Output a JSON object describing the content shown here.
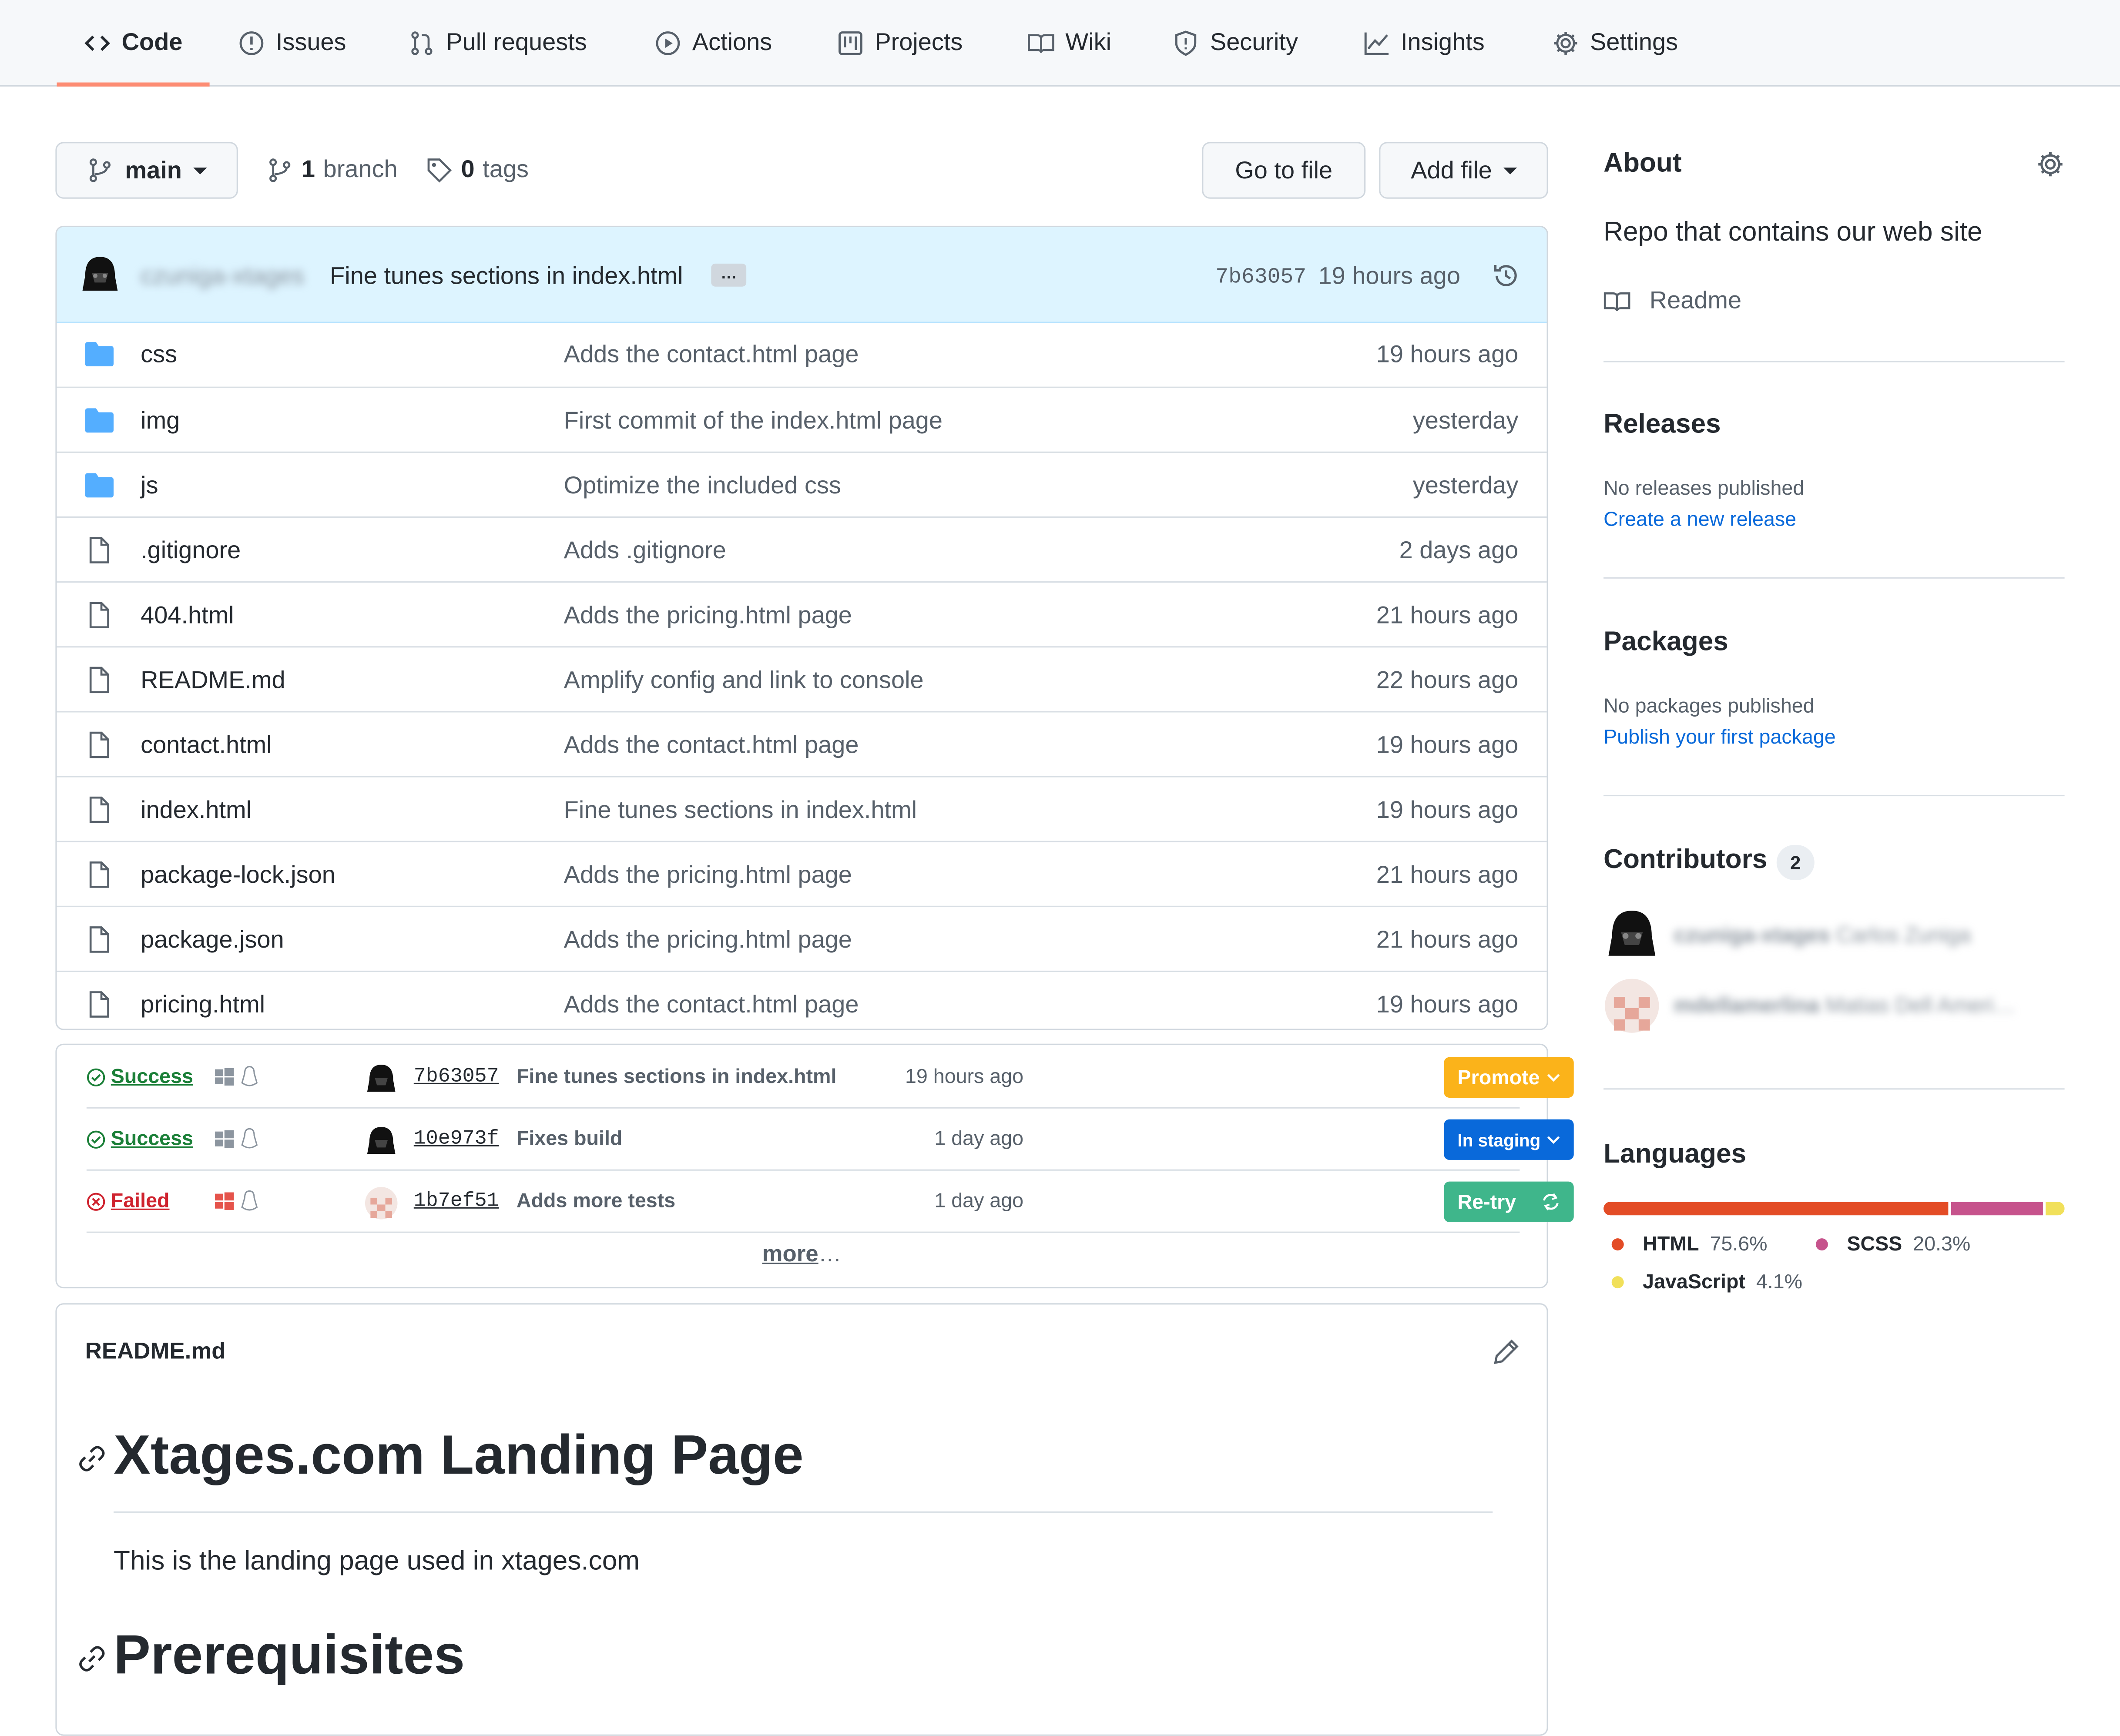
{
  "nav": {
    "tabs": [
      {
        "label": "Code",
        "icon": "code-icon"
      },
      {
        "label": "Issues",
        "icon": "issue-icon"
      },
      {
        "label": "Pull requests",
        "icon": "pull-request-icon"
      },
      {
        "label": "Actions",
        "icon": "play-icon"
      },
      {
        "label": "Projects",
        "icon": "project-icon"
      },
      {
        "label": "Wiki",
        "icon": "book-icon"
      },
      {
        "label": "Security",
        "icon": "shield-icon"
      },
      {
        "label": "Insights",
        "icon": "graph-icon"
      },
      {
        "label": "Settings",
        "icon": "gear-icon"
      }
    ]
  },
  "toolbar": {
    "branch_name": "main",
    "branch_count": "1",
    "branch_label": "branch",
    "tag_count": "0",
    "tag_label": "tags",
    "go_to_file": "Go to file",
    "add_file": "Add file"
  },
  "latest_commit": {
    "author": "czuniga-xtages",
    "message": "Fine tunes sections in index.html",
    "ellipsis": "…",
    "sha": "7b63057",
    "age": "19 hours ago"
  },
  "files": [
    {
      "name": "css",
      "type": "dir",
      "message": "Adds the contact.html page",
      "age": "19 hours ago"
    },
    {
      "name": "img",
      "type": "dir",
      "message": "First commit of the index.html page",
      "age": "yesterday"
    },
    {
      "name": "js",
      "type": "dir",
      "message": "Optimize the included css",
      "age": "yesterday"
    },
    {
      "name": ".gitignore",
      "type": "file",
      "message": "Adds .gitignore",
      "age": "2 days ago"
    },
    {
      "name": "404.html",
      "type": "file",
      "message": "Adds the pricing.html page",
      "age": "21 hours ago"
    },
    {
      "name": "README.md",
      "type": "file",
      "message": "Amplify config and link to console",
      "age": "22 hours ago"
    },
    {
      "name": "contact.html",
      "type": "file",
      "message": "Adds the contact.html page",
      "age": "19 hours ago"
    },
    {
      "name": "index.html",
      "type": "file",
      "message": "Fine tunes sections in index.html",
      "age": "19 hours ago"
    },
    {
      "name": "package-lock.json",
      "type": "file",
      "message": "Adds the pricing.html page",
      "age": "21 hours ago"
    },
    {
      "name": "package.json",
      "type": "file",
      "message": "Adds the pricing.html page",
      "age": "21 hours ago"
    },
    {
      "name": "pricing.html",
      "type": "file",
      "message": "Adds the contact.html page",
      "age": "19 hours ago"
    }
  ],
  "ci_runs": [
    {
      "status": "Success",
      "status_color": "#1a7f37",
      "sha": "7b63057",
      "message": "Fine tunes sections in index.html",
      "age": "19 hours ago",
      "action": "Promote",
      "action_color": "#f9a825"
    },
    {
      "status": "Success",
      "status_color": "#1a7f37",
      "sha": "10e973f",
      "message": "Fixes build",
      "age": "1 day ago",
      "action": "In staging",
      "action_color": "#0969da"
    },
    {
      "status": "Failed",
      "status_color": "#cf222e",
      "sha": "1b7ef51",
      "message": "Adds more tests",
      "age": "1 day ago",
      "action": "Re-try",
      "action_color": "#3fb68b"
    }
  ],
  "ci_more": {
    "link": "more",
    "suffix": "…"
  },
  "readme": {
    "filename": "README.md",
    "h1": "Xtages.com Landing Page",
    "p": "This is the landing page used in xtages.com",
    "h2": "Prerequisites"
  },
  "about": {
    "title": "About",
    "description": "Repo that contains our web site",
    "readme_link": "Readme"
  },
  "releases": {
    "title": "Releases",
    "empty": "No releases published",
    "link": "Create a new release"
  },
  "packages": {
    "title": "Packages",
    "empty": "No packages published",
    "link": "Publish your first package"
  },
  "contributors": {
    "title": "Contributors",
    "count": "2",
    "people": [
      {
        "login": "czuniga-xtages",
        "name": "Carlos Zuniga"
      },
      {
        "login": "mdellamerlina",
        "name": "Matias Dell Ameri…"
      }
    ]
  },
  "languages": {
    "title": "Languages",
    "items": [
      {
        "name": "HTML",
        "percent": "75.6%",
        "value": 75.6,
        "color": "#e34c26"
      },
      {
        "name": "SCSS",
        "percent": "20.3%",
        "value": 20.3,
        "color": "#c6538c"
      },
      {
        "name": "JavaScript",
        "percent": "4.1%",
        "value": 4.1,
        "color": "#f1e05a"
      }
    ]
  }
}
